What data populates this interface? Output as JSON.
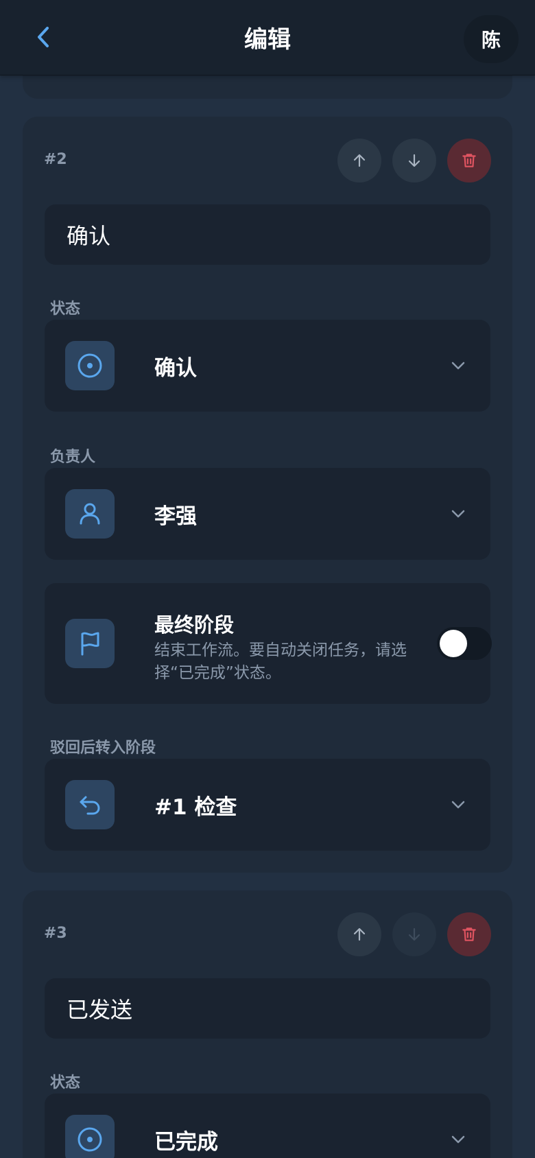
{
  "header": {
    "title": "编辑",
    "avatar_initial": "陈"
  },
  "stages": [
    {
      "number": "#2",
      "name": "确认",
      "status_label": "状态",
      "status_value": "确认",
      "assignee_label": "负责人",
      "assignee_value": "李强",
      "final_stage": {
        "title": "最终阶段",
        "description": "结束工作流。要自动关闭任务，请选择“已完成”状态。",
        "enabled": false
      },
      "reject_label": "驳回后转入阶段",
      "reject_value": "#1 检查",
      "move_down_enabled": true
    },
    {
      "number": "#3",
      "name": "已发送",
      "status_label": "状态",
      "status_value": "已完成",
      "move_down_enabled": false
    }
  ],
  "colors": {
    "accent": "#5aa7ee",
    "danger": "#e05461",
    "background": "#223042",
    "card": "#1f2b3a",
    "field": "#1a2330"
  }
}
